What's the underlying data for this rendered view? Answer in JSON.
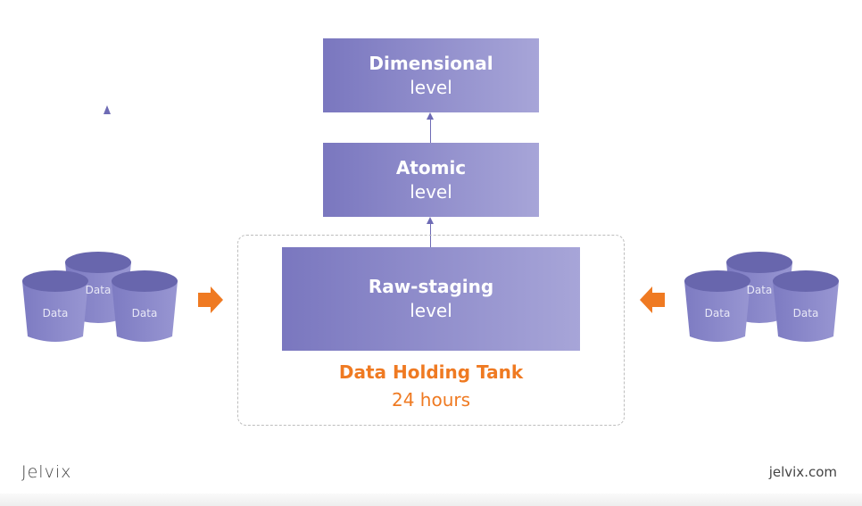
{
  "levels": {
    "dimensional": {
      "title": "Dimensional",
      "sub": "level"
    },
    "atomic": {
      "title": "Atomic",
      "sub": "level"
    },
    "raw": {
      "title": "Raw-staging",
      "sub": "level"
    }
  },
  "tank": {
    "title": "Data Holding Tank",
    "duration": "24 hours"
  },
  "bucket_label": "Data",
  "brand": {
    "logo": "Jelvix",
    "site": "jelvix.com"
  },
  "colors": {
    "box_start": "#7a77bf",
    "box_end": "#a7a5d8",
    "accent": "#ef7a22",
    "bucket": "#8886cc"
  }
}
